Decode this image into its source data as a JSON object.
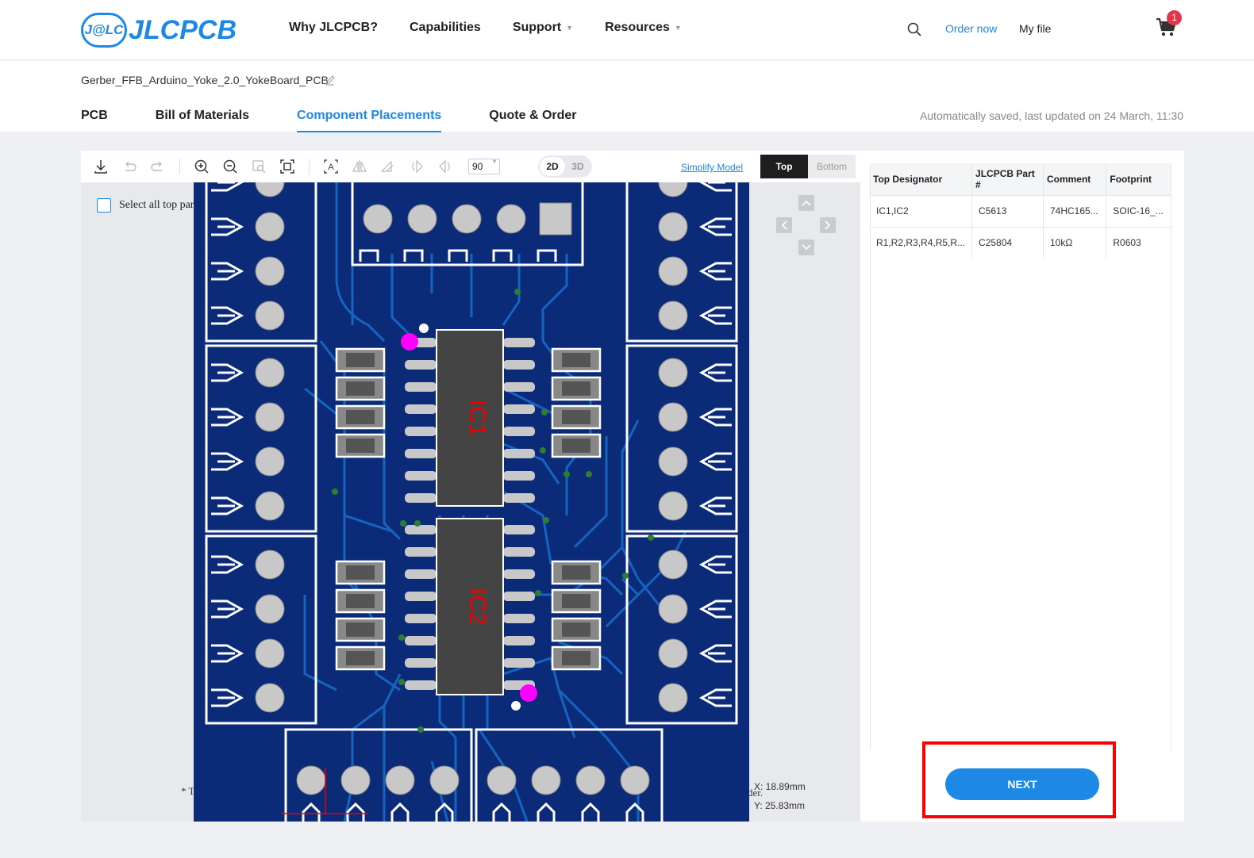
{
  "header": {
    "logo_badge": "J@LC",
    "logo_text": "JLCPCB",
    "nav": [
      {
        "label": "Why JLCPCB?",
        "caret": false
      },
      {
        "label": "Capabilities",
        "caret": false
      },
      {
        "label": "Support",
        "caret": true
      },
      {
        "label": "Resources",
        "caret": true
      }
    ],
    "order_now": "Order now",
    "my_file": "My file",
    "cart_count": "1",
    "accent_color": "#1e88e5"
  },
  "file": {
    "name": "Gerber_FFB_Arduino_Yoke_2.0_YokeBoard_PCB"
  },
  "tabs": [
    {
      "label": "PCB"
    },
    {
      "label": "Bill of Materials"
    },
    {
      "label": "Component Placements",
      "active": true
    },
    {
      "label": "Quote & Order"
    }
  ],
  "saved_note": "Automatically saved, last updated on 24 March, 11:30",
  "viewer": {
    "rotation": "90",
    "degree_symbol": "°",
    "dim_2d": "2D",
    "dim_3d": "3D",
    "simplify": "Simplify Model",
    "side_top": "Top",
    "side_bottom": "Bottom",
    "select_all": "Select all top parts",
    "footnote": "* T",
    "footnote2": "der.",
    "coord_x": "X:  18.89mm",
    "coord_y": "Y:  25.83mm",
    "ic_labels": [
      "IC1",
      "IC2"
    ],
    "pcb_color": "#0b2a78",
    "trace_color": "#1565c0"
  },
  "bom": {
    "columns": [
      "Top Designator",
      "JLCPCB Part #",
      "Comment",
      "Footprint"
    ],
    "rows": [
      [
        "IC1,IC2",
        "C5613",
        "74HC165...",
        "SOIC-16_..."
      ],
      [
        "R1,R2,R3,R4,R5,R...",
        "C25804",
        "10kΩ",
        "R0603"
      ]
    ]
  },
  "next_label": "NEXT"
}
